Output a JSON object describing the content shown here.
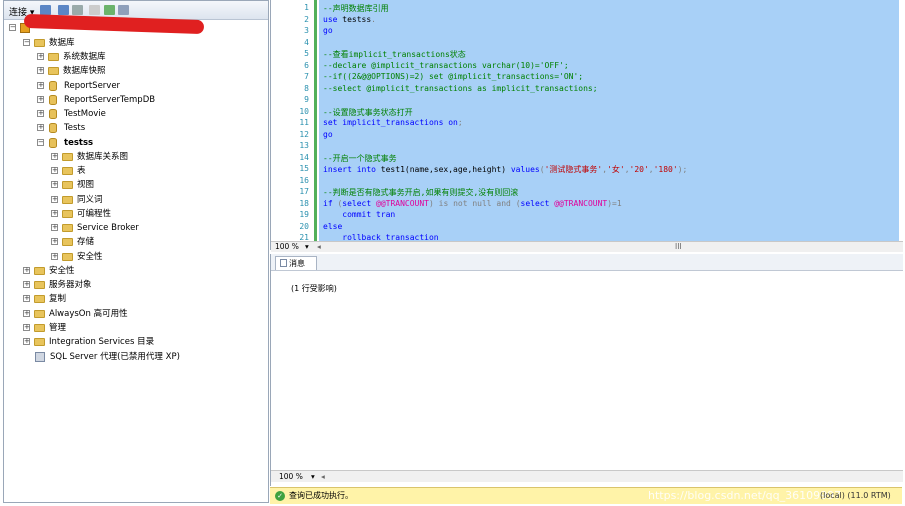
{
  "object_explorer": {
    "toolbar_label": "连接 ▾",
    "tree": [
      {
        "label": "数据库",
        "kind": "folder",
        "expander": "⊟"
      },
      {
        "label": "系统数据库",
        "kind": "folder",
        "expander": "⊞"
      },
      {
        "label": "数据库快照",
        "kind": "folder",
        "expander": "⊞"
      },
      {
        "label": "ReportServer",
        "kind": "db",
        "expander": "⊞"
      },
      {
        "label": "ReportServerTempDB",
        "kind": "db",
        "expander": "⊞"
      },
      {
        "label": "TestMovie",
        "kind": "db",
        "expander": "⊞"
      },
      {
        "label": "Tests",
        "kind": "db",
        "expander": "⊞"
      },
      {
        "label": "testss",
        "kind": "db",
        "expander": "⊟"
      },
      {
        "label": "数据库关系图",
        "kind": "folder",
        "expander": "⊞"
      },
      {
        "label": "表",
        "kind": "folder",
        "expander": "⊞"
      },
      {
        "label": "视图",
        "kind": "folder",
        "expander": "⊞"
      },
      {
        "label": "同义词",
        "kind": "folder",
        "expander": "⊞"
      },
      {
        "label": "可编程性",
        "kind": "folder",
        "expander": "⊞"
      },
      {
        "label": "Service Broker",
        "kind": "folder",
        "expander": "⊞"
      },
      {
        "label": "存储",
        "kind": "folder",
        "expander": "⊞"
      },
      {
        "label": "安全性",
        "kind": "folder",
        "expander": "⊞"
      },
      {
        "label": "安全性",
        "kind": "folder",
        "expander": "⊞"
      },
      {
        "label": "服务器对象",
        "kind": "folder",
        "expander": "⊞"
      },
      {
        "label": "复制",
        "kind": "folder",
        "expander": "⊞"
      },
      {
        "label": "AlwaysOn 高可用性",
        "kind": "folder",
        "expander": "⊞"
      },
      {
        "label": "管理",
        "kind": "folder",
        "expander": "⊞"
      },
      {
        "label": "Integration Services 目录",
        "kind": "folder",
        "expander": "⊞"
      },
      {
        "label": "SQL Server 代理(已禁用代理 XP)",
        "kind": "agent",
        "expander": ""
      }
    ]
  },
  "editor": {
    "line_numbers": [
      "1",
      "2",
      "3",
      "4",
      "5",
      "6",
      "7",
      "8",
      "9",
      "10",
      "11",
      "12",
      "13",
      "14",
      "15",
      "16",
      "17",
      "18",
      "19",
      "20",
      "21"
    ],
    "lines": [
      [
        {
          "t": "--声明数据库引用",
          "c": "cm"
        }
      ],
      [
        {
          "t": "use ",
          "c": "kw"
        },
        {
          "t": "testss",
          "c": ""
        },
        {
          "t": ".",
          "c": "gy"
        }
      ],
      [
        {
          "t": "go",
          "c": "kw"
        }
      ],
      [],
      [
        {
          "t": "--查看implicit_transactions状态",
          "c": "cm"
        }
      ],
      [
        {
          "t": "--declare @implicit_transactions varchar(10)='OFF';",
          "c": "cm"
        }
      ],
      [
        {
          "t": "--if((2&@@OPTIONS)=2) set @implicit_transactions='ON';",
          "c": "cm"
        }
      ],
      [
        {
          "t": "--select @implicit_transactions as implicit_transactions;",
          "c": "cm"
        }
      ],
      [],
      [
        {
          "t": "--设置隐式事务状态打开",
          "c": "cm"
        }
      ],
      [
        {
          "t": "set ",
          "c": "kw"
        },
        {
          "t": "implicit_transactions ",
          "c": "kw"
        },
        {
          "t": "on",
          "c": "kw"
        },
        {
          "t": ";",
          "c": "gy"
        }
      ],
      [
        {
          "t": "go",
          "c": "kw"
        }
      ],
      [],
      [
        {
          "t": "--开启一个隐式事务",
          "c": "cm"
        }
      ],
      [
        {
          "t": "insert into ",
          "c": "kw"
        },
        {
          "t": "test1(name,sex,age,height) ",
          "c": ""
        },
        {
          "t": "values",
          "c": "kw"
        },
        {
          "t": "(",
          "c": "gy"
        },
        {
          "t": "'测试隐式事务'",
          "c": "st"
        },
        {
          "t": ",",
          "c": "gy"
        },
        {
          "t": "'女'",
          "c": "st"
        },
        {
          "t": ",",
          "c": "gy"
        },
        {
          "t": "'20'",
          "c": "st"
        },
        {
          "t": ",",
          "c": "gy"
        },
        {
          "t": "'180'",
          "c": "st"
        },
        {
          "t": ");",
          "c": "gy"
        }
      ],
      [],
      [
        {
          "t": "--判断是否有隐式事务开启,如果有则提交,没有则回滚",
          "c": "cm"
        }
      ],
      [
        {
          "t": "if ",
          "c": "kw"
        },
        {
          "t": "(",
          "c": "gy"
        },
        {
          "t": "select ",
          "c": "kw"
        },
        {
          "t": "@@TRANCOUNT",
          "c": "pk"
        },
        {
          "t": ") ",
          "c": "gy"
        },
        {
          "t": "is not null and ",
          "c": "gy"
        },
        {
          "t": "(",
          "c": "gy"
        },
        {
          "t": "select ",
          "c": "kw"
        },
        {
          "t": "@@TRANCOUNT",
          "c": "pk"
        },
        {
          "t": ")=1",
          "c": "gy"
        }
      ],
      [
        {
          "t": "    commit tran",
          "c": "kw"
        }
      ],
      [
        {
          "t": "else",
          "c": "kw"
        }
      ],
      [
        {
          "t": "    rollback transaction",
          "c": "kw"
        }
      ]
    ],
    "zoom": "100 %",
    "scroll_marker": "III"
  },
  "results": {
    "tab_label": "消息",
    "message": "(1 行受影响)",
    "zoom": "100 %"
  },
  "status": {
    "text": "查询已成功执行。",
    "watermark": "https://blog.csdn.net/qq_36109997",
    "server": "(local) (11.0 RTM)"
  }
}
